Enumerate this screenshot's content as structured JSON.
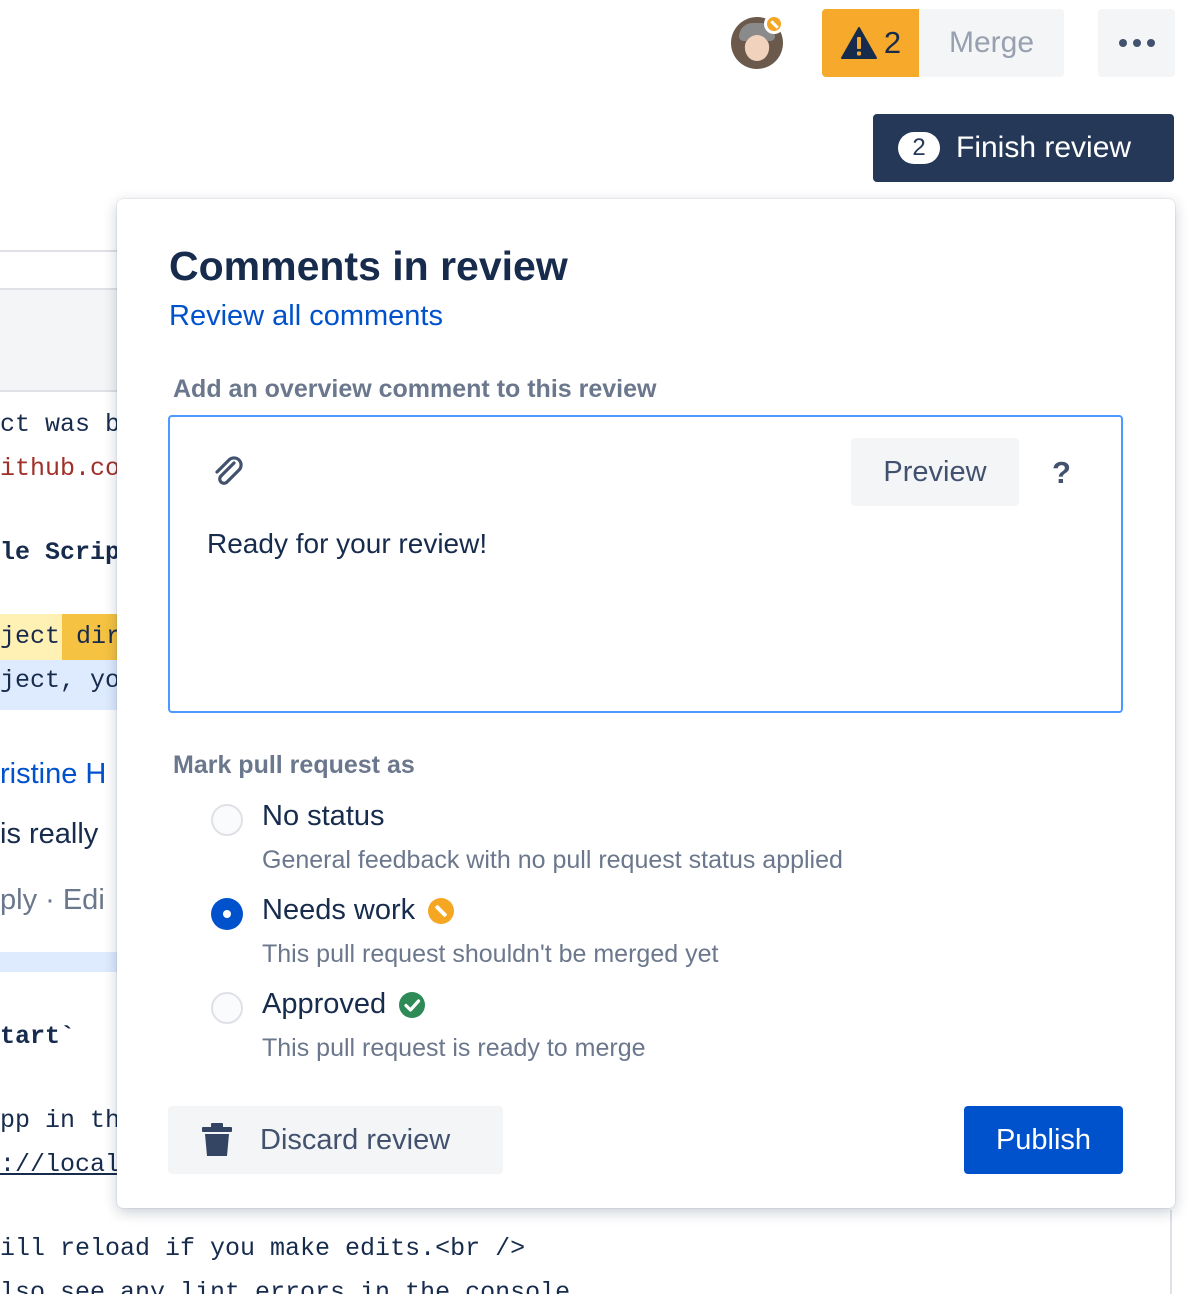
{
  "toolbar": {
    "warning_count": "2",
    "merge_label": "Merge",
    "finish_review_count": "2",
    "finish_review_label": "Finish review",
    "icons": [
      "avatar",
      "warning-icon",
      "more-icon"
    ]
  },
  "background": {
    "code_lines": [
      "ct was b",
      "ithub.co",
      "le Scrip",
      "ject",
      "dir",
      "ject, yo",
      "tart`",
      "pp in th",
      "://local",
      "ill reload if you make edits.<br />",
      "lso see any lint errors in the console."
    ],
    "comment_author": "ristine H",
    "comment_text": "is really",
    "comment_actions": "ply · Edi"
  },
  "dialog": {
    "title": "Comments in review",
    "review_all_link": "Review all comments",
    "overview_label": "Add an overview comment to this review",
    "editor": {
      "preview_label": "Preview",
      "help_label": "?",
      "text": "Ready for your review!"
    },
    "status_label": "Mark pull request as",
    "options": [
      {
        "title": "No status",
        "description": "General feedback with no pull request status applied",
        "checked": false
      },
      {
        "title": "Needs work",
        "description": "This pull request shouldn't be merged yet",
        "checked": true,
        "icon": "needs-work-icon",
        "icon_color": "#f5a623"
      },
      {
        "title": "Approved",
        "description": "This pull request is ready to merge",
        "checked": false,
        "icon": "approved-icon",
        "icon_color": "#2e8b57"
      }
    ],
    "discard_label": "Discard review",
    "publish_label": "Publish"
  },
  "colors": {
    "primary": "#0052cc",
    "finish_review_bg": "#253858",
    "warning": "#f6a92b",
    "editor_focus": "#4c9aff"
  }
}
